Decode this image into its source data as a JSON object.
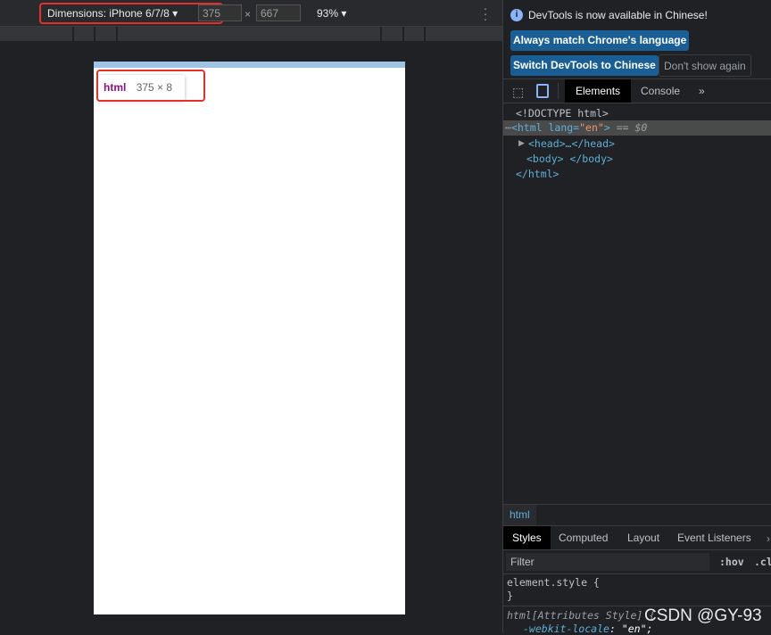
{
  "device_toolbar": {
    "device_label": "Dimensions: iPhone 6/7/8",
    "width": "375",
    "height": "667",
    "times": "×",
    "zoom": "93%",
    "more_icon": "more-vert-icon"
  },
  "tooltip": {
    "tag": "html",
    "size": "375 × 8"
  },
  "infobar": {
    "message": "DevTools is now available in Chinese!",
    "btn_match": "Always match Chrome's language",
    "btn_switch": "Switch DevTools to Chinese",
    "btn_dont": "Don't show again"
  },
  "tabs": {
    "elements": "Elements",
    "console": "Console",
    "more": "»"
  },
  "dom": {
    "doctype": "<!DOCTYPE html>",
    "html_open": "<html lang=",
    "lang_val": "\"en\"",
    "html_close_bracket": ">",
    "selected_marker": "== $0",
    "head": "<head>…</head>",
    "body": "<body> </body>",
    "html_close": "</html>"
  },
  "breadcrumb": "html",
  "styles_tabs": [
    "Styles",
    "Computed",
    "Layout",
    "Event Listeners"
  ],
  "filter_placeholder": "Filter",
  "hov": ":hov",
  "cls": ".cl",
  "styles": {
    "element_style": "element.style {",
    "close": "}",
    "attr_rule": "html[Attributes Style] {",
    "prop": "-webkit-locale",
    "val": "\"en\";"
  },
  "watermark": "CSDN @GY-93",
  "colors": {
    "accent": "#1a5e96",
    "highlight": "#e5302a",
    "tag": "#5db0d7",
    "attr_value": "#f29766"
  }
}
